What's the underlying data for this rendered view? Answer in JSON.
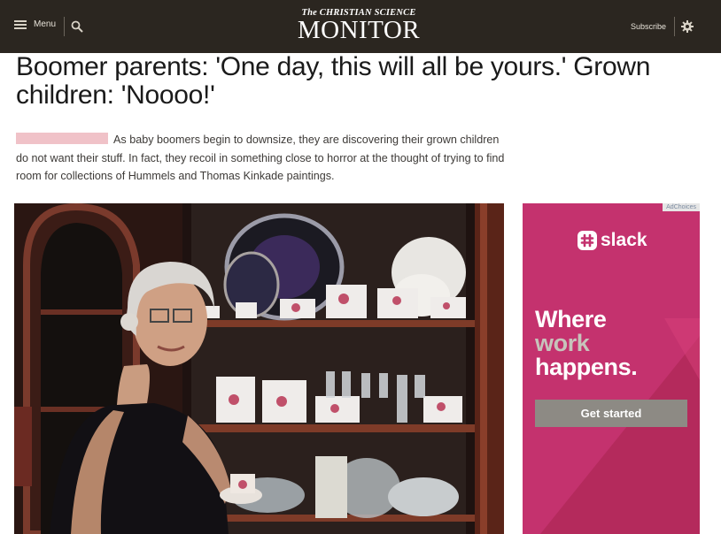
{
  "header": {
    "menu_label": "Menu",
    "logo_top": "The CHRISTIAN SCIENCE",
    "logo_main": "MONITOR",
    "subscribe_label": "Subscribe"
  },
  "article": {
    "headline": "Boomer parents: 'One day, this will all be yours.' Grown children: 'Noooo!'",
    "summary": "As baby boomers begin to downsize, they are discovering their grown children do not want their stuff. In fact, they recoil in something close to horror at the thought of trying to find room for collections of Hummels and Thomas Kinkade paintings."
  },
  "ad": {
    "adchoices": "AdChoices",
    "brand": "slack",
    "headline_line1": "Where",
    "headline_line2": "work",
    "headline_line3": "happens.",
    "cta": "Get started",
    "colors": {
      "background": "#c4326e",
      "line2": "#c7c3bb",
      "button": "#8d8a84"
    }
  },
  "colors": {
    "header_bg": "#2b2620",
    "headline": "#1a1a1a",
    "body_text": "#3d3a37"
  }
}
